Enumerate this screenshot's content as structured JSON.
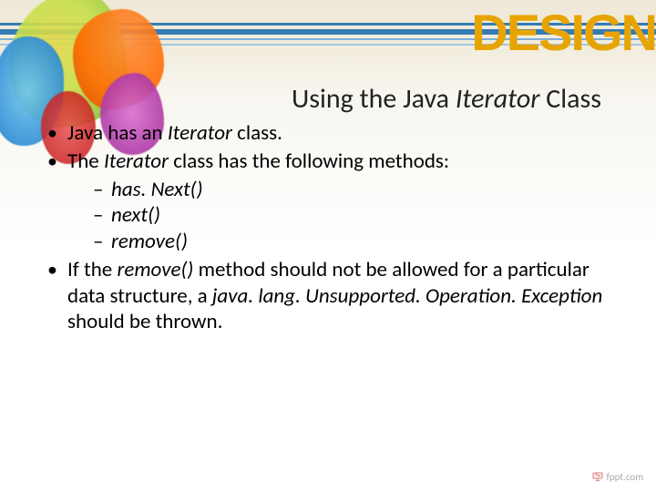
{
  "logo": "DESIGN",
  "title": {
    "prefix": "Using the Java ",
    "italic": "Iterator",
    "suffix": " Class"
  },
  "bullets": [
    {
      "segments": [
        {
          "t": "Java has an "
        },
        {
          "t": "Iterator",
          "i": true
        },
        {
          "t": " class."
        }
      ]
    },
    {
      "segments": [
        {
          "t": "The "
        },
        {
          "t": "Iterator",
          "i": true
        },
        {
          "t": " class has the following methods:"
        }
      ],
      "sub": [
        {
          "segments": [
            {
              "t": "has. Next()",
              "i": true
            }
          ]
        },
        {
          "segments": [
            {
              "t": "next()",
              "i": true
            }
          ]
        },
        {
          "segments": [
            {
              "t": "remove()",
              "i": true
            }
          ]
        }
      ]
    },
    {
      "segments": [
        {
          "t": "If the "
        },
        {
          "t": "remove()",
          "i": true
        },
        {
          "t": " method should not be allowed for a particular data structure, a "
        },
        {
          "t": "java. lang. Unsupported. Operation. Exception",
          "i": true
        },
        {
          "t": " should be thrown."
        }
      ]
    }
  ],
  "footer": "fppt.com"
}
